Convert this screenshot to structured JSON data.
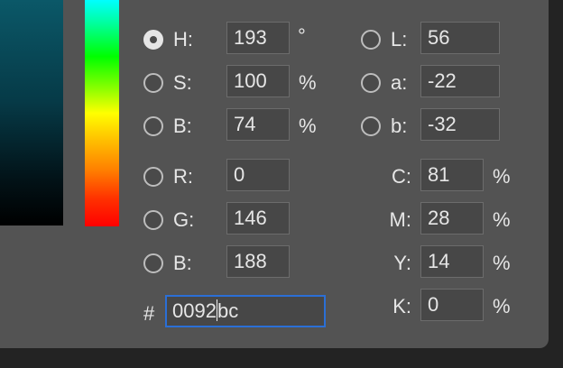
{
  "hsb": {
    "h": {
      "label": "H:",
      "value": "193",
      "unit": "°",
      "selected": true
    },
    "s": {
      "label": "S:",
      "value": "100",
      "unit": "%"
    },
    "b": {
      "label": "B:",
      "value": "74",
      "unit": "%"
    }
  },
  "lab": {
    "l": {
      "label": "L:",
      "value": "56"
    },
    "a": {
      "label": "a:",
      "value": "-22"
    },
    "b": {
      "label": "b:",
      "value": "-32"
    }
  },
  "rgb": {
    "r": {
      "label": "R:",
      "value": "0"
    },
    "g": {
      "label": "G:",
      "value": "146"
    },
    "b": {
      "label": "B:",
      "value": "188"
    }
  },
  "cmyk": {
    "c": {
      "label": "C:",
      "value": "81",
      "unit": "%"
    },
    "m": {
      "label": "M:",
      "value": "28",
      "unit": "%"
    },
    "y": {
      "label": "Y:",
      "value": "14",
      "unit": "%"
    },
    "k": {
      "label": "K:",
      "value": "0",
      "unit": "%"
    }
  },
  "hex": {
    "label": "#",
    "value_before_caret": "0092",
    "value_after_caret": "bc"
  },
  "colors": {
    "accent_focus": "#2b6fd6",
    "panel_bg": "#535353",
    "current_color": "#0092bc"
  }
}
